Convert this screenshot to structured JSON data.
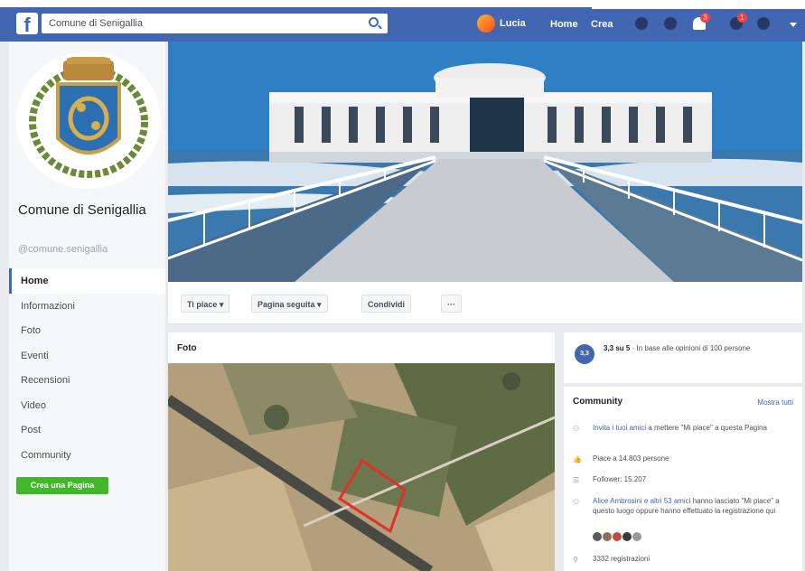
{
  "topbar": {
    "logo": "f",
    "search_value": "Comune di Senigallia",
    "user_name": "Lucia",
    "home_label": "Home",
    "create_label": "Crea",
    "notif_badge": "3",
    "friends_badge": "1"
  },
  "sidebar": {
    "page_name": "Comune di Senigallia",
    "username": "@comune.senigallia",
    "items": [
      {
        "label": "Home"
      },
      {
        "label": "Informazioni"
      },
      {
        "label": "Foto"
      },
      {
        "label": "Eventi"
      },
      {
        "label": "Recensioni"
      },
      {
        "label": "Video"
      },
      {
        "label": "Post"
      },
      {
        "label": "Community"
      }
    ],
    "create_page_button": "Crea una Pagina"
  },
  "actions": {
    "like": "Ti piace",
    "follow": "Pagina seguita",
    "share": "Condividi",
    "more": "···"
  },
  "photos": {
    "title": "Foto"
  },
  "rating": {
    "score": "3,3",
    "value": "3,3 su 5",
    "text": " · In base alle opinioni di 100 persone"
  },
  "community": {
    "title": "Community",
    "see_all": "Mostra tutti",
    "invite_link": "Invita i tuoi amici",
    "invite_text": " a mettere \"Mi piace\" a questa Pagina",
    "likes": "Piace a 14.803 persone",
    "followers": "Follower: 15.207",
    "friends_link": "Alice Ambrosini e altri 53 amici",
    "friends_text": " hanno lasciato \"Mi piace\" a questo luogo oppure hanno effettuato la registrazione qui",
    "checkins": "3332 registrazioni"
  },
  "colors": {
    "fb_blue": "#4267b2",
    "green": "#42b72a",
    "bg": "#e9ebee"
  }
}
